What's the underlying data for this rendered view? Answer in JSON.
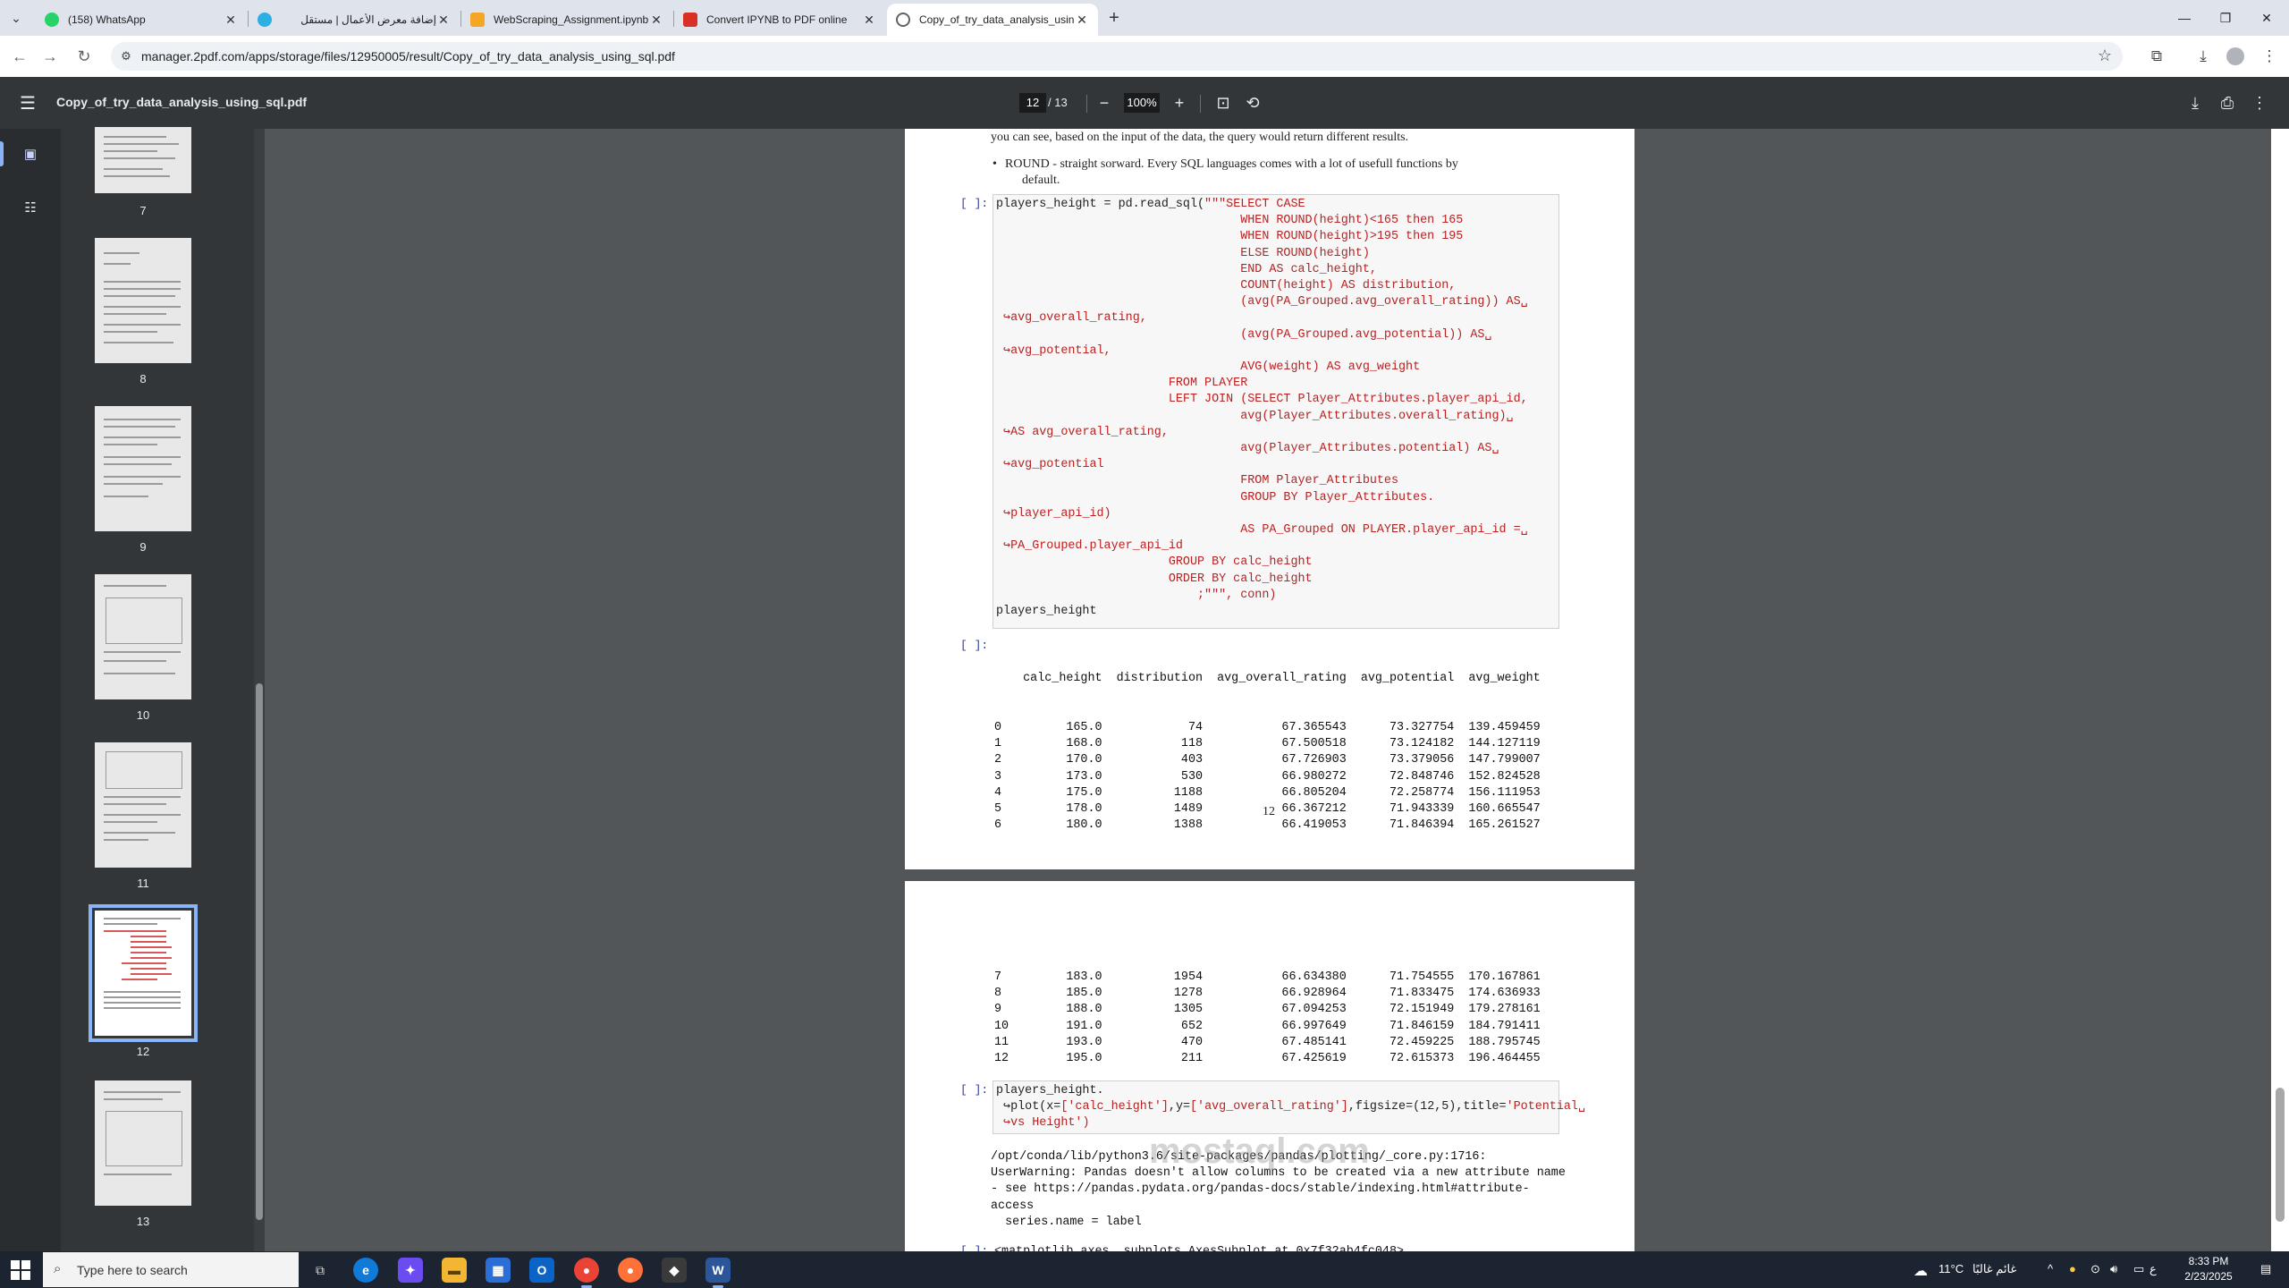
{
  "browser": {
    "tabs": [
      {
        "title": "(158) WhatsApp",
        "favicon_color": "#25d366",
        "active": false
      },
      {
        "title": "إضافة معرض الأعمال | مستقل",
        "favicon_color": "#2ab0e3",
        "active": false
      },
      {
        "title": "WebScraping_Assignment.ipynb",
        "favicon_color": "#f5a623",
        "active": false
      },
      {
        "title": "Convert IPYNB to PDF online",
        "favicon_color": "#d93025",
        "active": false
      },
      {
        "title": "Copy_of_try_data_analysis_usin",
        "favicon_color": "#5f6368",
        "active": true
      }
    ],
    "url": "manager.2pdf.com/apps/storage/files/12950005/result/Copy_of_try_data_analysis_using_sql.pdf"
  },
  "pdf_viewer": {
    "title": "Copy_of_try_data_analysis_using_sql.pdf",
    "current_page": "12",
    "page_count": "/ 13",
    "zoom": "100%",
    "thumbnails": [
      {
        "label": "7",
        "selected": false
      },
      {
        "label": "8",
        "selected": false
      },
      {
        "label": "9",
        "selected": false
      },
      {
        "label": "10",
        "selected": false
      },
      {
        "label": "11",
        "selected": false
      },
      {
        "label": "12",
        "selected": true
      },
      {
        "label": "13",
        "selected": false
      }
    ]
  },
  "page12": {
    "intro_line1": "you can see, based on the input of the data, the query would return different results.",
    "bullet": "ROUND - straight sorward.  Every SQL languages comes with a lot of usefull functions by",
    "bullet_cont": "default.",
    "cell_prompt": "[ ]:",
    "code_lines": [
      "players_height = pd.read_sql(\"\"\"SELECT CASE",
      "                                  WHEN ROUND(height)<165 then 165",
      "                                  WHEN ROUND(height)>195 then 195",
      "                                  ELSE ROUND(height)",
      "                                  END AS calc_height,",
      "                                  COUNT(height) AS distribution,",
      "                                  (avg(PA_Grouped.avg_overall_rating)) AS␣",
      " ↪avg_overall_rating,",
      "                                  (avg(PA_Grouped.avg_potential)) AS␣",
      " ↪avg_potential,",
      "                                  AVG(weight) AS avg_weight",
      "                        FROM PLAYER",
      "                        LEFT JOIN (SELECT Player_Attributes.player_api_id,",
      "                                  avg(Player_Attributes.overall_rating)␣",
      " ↪AS avg_overall_rating,",
      "                                  avg(Player_Attributes.potential) AS␣",
      " ↪avg_potential",
      "                                  FROM Player_Attributes",
      "                                  GROUP BY Player_Attributes.",
      " ↪player_api_id)",
      "                                  AS PA_Grouped ON PLAYER.player_api_id =␣",
      " ↪PA_Grouped.player_api_id",
      "                        GROUP BY calc_height",
      "                        ORDER BY calc_height",
      "                            ;\"\"\", conn)"
    ],
    "code_last": "players_height",
    "output_prompt": "[ ]:",
    "table_header": "    calc_height  distribution  avg_overall_rating  avg_potential  avg_weight",
    "table_rows": [
      "0         165.0            74           67.365543      73.327754  139.459459",
      "1         168.0           118           67.500518      73.124182  144.127119",
      "2         170.0           403           67.726903      73.379056  147.799007",
      "3         173.0           530           66.980272      72.848746  152.824528",
      "4         175.0          1188           66.805204      72.258774  156.111953",
      "5         178.0          1489           66.367212      71.943339  160.665547",
      "6         180.0          1388           66.419053      71.846394  165.261527"
    ],
    "page_number": "12"
  },
  "page13": {
    "table_rows": [
      "7         183.0          1954           66.634380      71.754555  170.167861",
      "8         185.0          1278           66.928964      71.833475  174.636933",
      "9         188.0          1305           67.094253      72.151949  179.278161",
      "10        191.0           652           66.997649      71.846159  184.791411",
      "11        193.0           470           67.485141      72.459225  188.795745",
      "12        195.0           211           67.425619      72.615373  196.464455"
    ],
    "cell_prompt": "[ ]:",
    "code_line1": "players_height.",
    "code_line2_pre": " ↪plot(x=",
    "code_line2_s1": "['calc_height']",
    "code_line2_mid": ",y=",
    "code_line2_s2": "['avg_overall_rating']",
    "code_line2_post": ",figsize=(12,5),title=",
    "code_line2_s3": "'Potential␣",
    "code_line3": " ↪vs Height')",
    "warning_lines": [
      "/opt/conda/lib/python3.6/site-packages/pandas/plotting/_core.py:1716:",
      "UserWarning: Pandas doesn't allow columns to be created via a new attribute name",
      "- see https://pandas.pydata.org/pandas-docs/stable/indexing.html#attribute-",
      "access",
      "  series.name = label"
    ],
    "last_prompt": "[ ]:",
    "last_line": "<matplotlib.axes._subplots.AxesSubplot at 0x7f32ab4fc048>"
  },
  "watermark": "mostaql.com",
  "taskbar": {
    "search_placeholder": "Type here to search",
    "weather": "11°C",
    "weather_text": "غائم غالبًا",
    "keyboard_lang": "ع",
    "time": "8:33 PM",
    "date": "2/23/2025"
  }
}
